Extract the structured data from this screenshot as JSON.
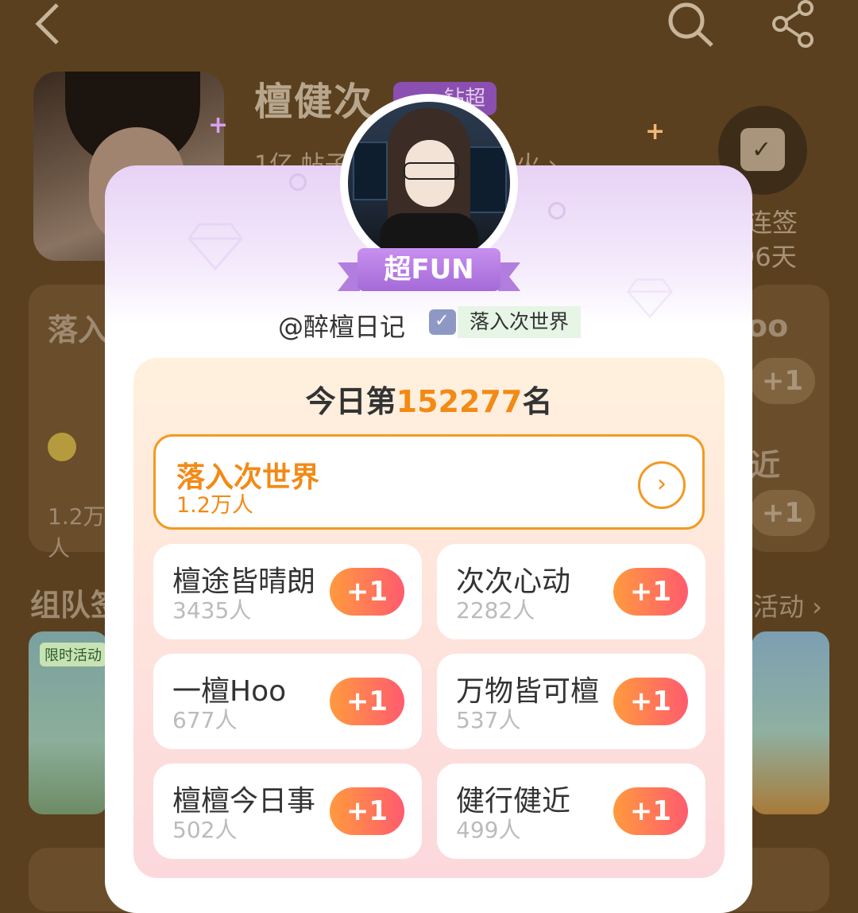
{
  "background": {
    "title": "檀健次",
    "badge": "钻超",
    "sub_left": "1亿 帖子",
    "sub_right": "炭火 ›",
    "checkin_line1": "连签",
    "checkin_line2": "96天",
    "card_left_title": "落入",
    "card_left_count": "1.2万人",
    "card_right_top": "oo",
    "card_right_mid": "近",
    "plus_one": "+1",
    "section_left": "组队签",
    "section_right": "活动 ›",
    "tag_limited": "限时活动"
  },
  "modal": {
    "ribbon_label": "超FUN",
    "username": "@醉檀日记",
    "user_tag": "落入次世界",
    "rank_prefix": "今日第",
    "rank_number": "152277",
    "rank_suffix": "名",
    "main_group": {
      "name": "落入次世界",
      "count": "1.2万人"
    },
    "plus_label": "+1",
    "groups": [
      {
        "name": "檀途皆晴朗",
        "count": "3435人"
      },
      {
        "name": "次次心动",
        "count": "2282人"
      },
      {
        "name": "一檀Hoo",
        "count": "677人"
      },
      {
        "name": "万物皆可檀",
        "count": "537人"
      },
      {
        "name": "檀檀今日事",
        "count": "502人"
      },
      {
        "name": "健行健近",
        "count": "499人"
      }
    ]
  },
  "icons": {
    "back": "back-arrow-icon",
    "search": "search-icon",
    "share": "share-icon",
    "calendar": "calendar-check-icon"
  }
}
